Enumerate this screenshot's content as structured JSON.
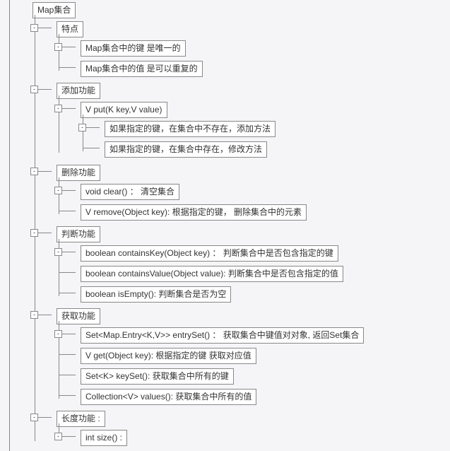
{
  "root": {
    "label": "Map集合"
  },
  "sections": {
    "features": {
      "label": "特点",
      "items": [
        "Map集合中的键 是唯一的",
        "Map集合中的值 是可以重复的"
      ]
    },
    "add": {
      "label": "添加功能",
      "method": "V put(K key,V value)",
      "sub": [
        "如果指定的键，在集合中不存在，添加方法",
        "如果指定的键，在集合中存在，修改方法"
      ]
    },
    "remove": {
      "label": "删除功能",
      "items": [
        "void clear() ： 清空集合",
        "V remove(Object key): 根据指定的键， 删除集合中的元素"
      ]
    },
    "judge": {
      "label": "判断功能",
      "items": [
        "boolean containsKey(Object key) ： 判断集合中是否包含指定的键",
        "boolean containsValue(Object value): 判断集合中是否包含指定的值",
        "boolean isEmpty(): 判断集合是否为空"
      ]
    },
    "get": {
      "label": "获取功能",
      "items": [
        "Set<Map.Entry<K,V>> entrySet()  ： 获取集合中键值对对象, 返回Set集合",
        "V get(Object key): 根据指定的键 获取对应值",
        "Set<K> keySet(): 获取集合中所有的键",
        "Collection<V> values(): 获取集合中所有的值"
      ]
    },
    "length": {
      "label": "长度功能 :",
      "items": [
        "int size() :"
      ]
    }
  },
  "toggle_glyph": "-"
}
